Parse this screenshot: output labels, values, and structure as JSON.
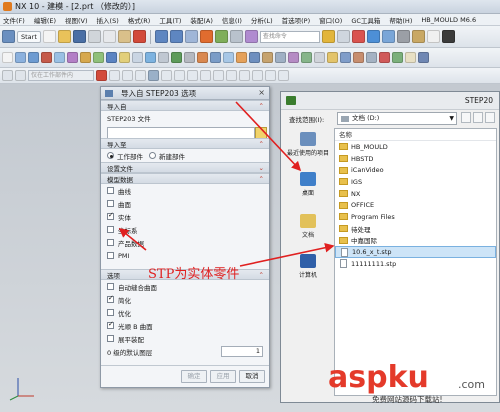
{
  "window": {
    "title": "NX 10 - 建模 - [2.prt （修改的）]",
    "menu": [
      "文件(F)",
      "编辑(E)",
      "视图(V)",
      "插入(S)",
      "格式(R)",
      "工具(T)",
      "装配(A)",
      "信息(I)",
      "分析(L)",
      "首选项(P)",
      "窗口(O)",
      "GC工具箱",
      "帮助(H)",
      "HB_MOULD M6.6"
    ]
  },
  "toolbar": {
    "start_label": "Start",
    "search_placeholder": "查找命令",
    "filter_placeholder": "仅在工作部件内"
  },
  "import_dialog": {
    "title": "导入自 STEP203 选项",
    "sections": {
      "import_from": "导入自",
      "step_file_label": "STEP203 文件",
      "import_to": "导入至",
      "work_part": "工作部件",
      "new_part": "新建部件",
      "settings_file": "设置文件",
      "model_data": "模型数据",
      "options": "选项"
    },
    "model_items": [
      {
        "label": "曲线",
        "checked": false
      },
      {
        "label": "曲面",
        "checked": false
      },
      {
        "label": "实体",
        "checked": true
      },
      {
        "label": "坐标系",
        "checked": false
      },
      {
        "label": "产品数据",
        "checked": false
      },
      {
        "label": "PMI",
        "checked": false
      }
    ],
    "option_items": [
      {
        "label": "自动缝合曲面",
        "checked": false
      },
      {
        "label": "简化",
        "checked": true
      },
      {
        "label": "优化",
        "checked": false
      },
      {
        "label": "光顺 B 曲面",
        "checked": true
      },
      {
        "label": "展平装配",
        "checked": false
      }
    ],
    "default_factor_label": "0 级的默认图层",
    "default_factor_value": "1",
    "buttons": {
      "ok": "确定",
      "apply": "应用",
      "cancel": "取消"
    }
  },
  "open_dialog": {
    "title": "STEP20",
    "lookin_label": "查找范围(I):",
    "lookin_value": "文档 (D:)",
    "column_name": "名称",
    "places": [
      {
        "label": "最近使用的项目"
      },
      {
        "label": "桌面"
      },
      {
        "label": "文档"
      },
      {
        "label": "计算机"
      }
    ],
    "files": [
      {
        "name": "HB_MOULD",
        "type": "folder"
      },
      {
        "name": "HBSTD",
        "type": "folder"
      },
      {
        "name": "iCanVideo",
        "type": "folder"
      },
      {
        "name": "IGS",
        "type": "folder"
      },
      {
        "name": "NX",
        "type": "folder"
      },
      {
        "name": "OFFICE",
        "type": "folder"
      },
      {
        "name": "Program Files",
        "type": "folder"
      },
      {
        "name": "待处理",
        "type": "folder"
      },
      {
        "name": "中嘉国际",
        "type": "folder"
      },
      {
        "name": "10.6_x_t.stp",
        "type": "file",
        "selected": true
      },
      {
        "name": "11111111.stp",
        "type": "file"
      }
    ]
  },
  "annotation": {
    "text": "STP为实体零件",
    "color": "#e02020"
  },
  "watermark": {
    "main": "aspku",
    "suffix": ".com",
    "sub": "免费网站源码下载站!"
  }
}
